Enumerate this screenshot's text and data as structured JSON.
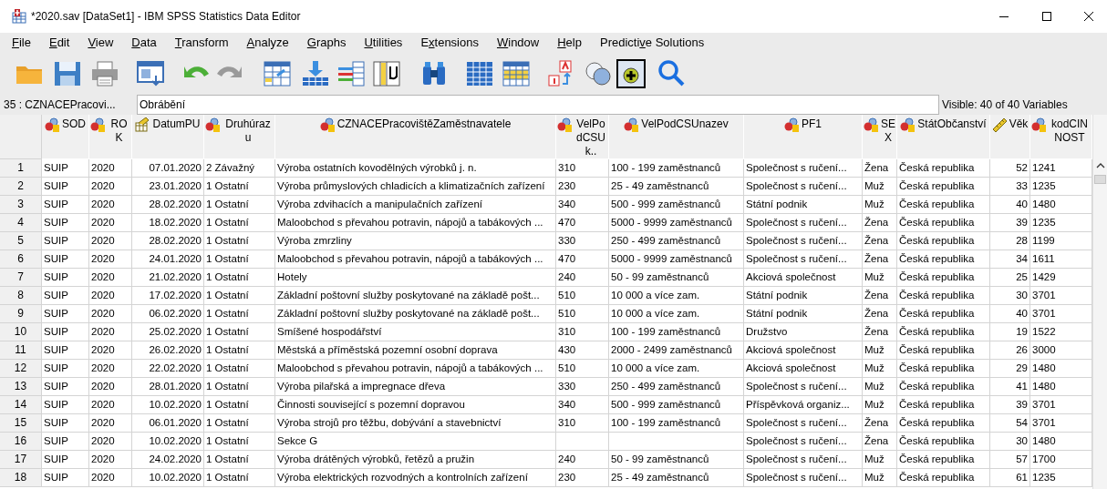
{
  "window": {
    "title": "*2020.sav [DataSet1] - IBM SPSS Statistics Data Editor"
  },
  "menu": [
    {
      "access_key": "F",
      "after": "ile"
    },
    {
      "access_key": "E",
      "after": "dit"
    },
    {
      "access_key": "V",
      "after": "iew"
    },
    {
      "access_key": "D",
      "after": "ata"
    },
    {
      "access_key": "T",
      "after": "ransform"
    },
    {
      "access_key": "A",
      "after": "nalyze"
    },
    {
      "access_key": "G",
      "after": "raphs"
    },
    {
      "access_key": "U",
      "after": "tilities"
    },
    {
      "before": "E",
      "access_key": "x",
      "after": "tensions"
    },
    {
      "access_key": "W",
      "after": "indow"
    },
    {
      "access_key": "H",
      "after": "elp"
    },
    {
      "before": "Predicti",
      "access_key": "v",
      "after": "e Solutions"
    }
  ],
  "cell_editor": {
    "cell_reference": "35 : CZNACEPracovi...",
    "value": "Obrábění",
    "visible_variables": "Visible: 40 of 40 Variables"
  },
  "table": {
    "columns": [
      {
        "label": "SOD",
        "kind": "nominal"
      },
      {
        "label": "ROK",
        "kind": "nominal"
      },
      {
        "label": "DatumPU",
        "kind": "date"
      },
      {
        "label": "Druhúrazu",
        "kind": "nominal"
      },
      {
        "label": "CZNACEPracovištěZaměstnavatele",
        "kind": "nominal"
      },
      {
        "label": "VelPodCSUk..",
        "kind": "nominal"
      },
      {
        "label": "VelPodCSUnazev",
        "kind": "nominal"
      },
      {
        "label": "PF1",
        "kind": "nominal"
      },
      {
        "label": "SEX",
        "kind": "nominal"
      },
      {
        "label": "StátObčanství",
        "kind": "nominal"
      },
      {
        "label": "Věk",
        "kind": "scale"
      },
      {
        "label": "kodCINNOST",
        "kind": "nominal"
      }
    ],
    "rows": [
      {
        "number": "1",
        "cells": [
          "SUIP",
          "2020",
          "07.01.2020",
          "2 Závažný",
          "Výroba ostatních kovodělných výrobků j. n.",
          "310",
          "100 - 199 zaměstnanců",
          "Společnost s ručení...",
          "Žena",
          "Česká republika",
          "52",
          "1241"
        ]
      },
      {
        "number": "2",
        "cells": [
          "SUIP",
          "2020",
          "23.01.2020",
          "1 Ostatní",
          "Výroba průmyslových chladicích a klimatizačních zařízení",
          "230",
          "25 - 49 zaměstnanců",
          "Společnost s ručení...",
          "Muž",
          "Česká republika",
          "33",
          "1235"
        ]
      },
      {
        "number": "3",
        "cells": [
          "SUIP",
          "2020",
          "28.02.2020",
          "1 Ostatní",
          "Výroba zdvihacích a manipulačních zařízení",
          "340",
          "500 - 999 zaměstnanců",
          "Státní podnik",
          "Muž",
          "Česká republika",
          "40",
          "1480"
        ]
      },
      {
        "number": "4",
        "cells": [
          "SUIP",
          "2020",
          "18.02.2020",
          "1 Ostatní",
          "Maloobchod s převahou potravin, nápojů a tabákových ...",
          "470",
          "5000 - 9999 zaměstnanců",
          "Společnost s ručení...",
          "Žena",
          "Česká republika",
          "39",
          "1235"
        ]
      },
      {
        "number": "5",
        "cells": [
          "SUIP",
          "2020",
          "28.02.2020",
          "1 Ostatní",
          "Výroba zmrzliny",
          "330",
          "250 - 499 zaměstnanců",
          "Společnost s ručení...",
          "Žena",
          "Česká republika",
          "28",
          "1199"
        ]
      },
      {
        "number": "6",
        "cells": [
          "SUIP",
          "2020",
          "24.01.2020",
          "1 Ostatní",
          "Maloobchod s převahou potravin, nápojů a tabákových ...",
          "470",
          "5000 - 9999 zaměstnanců",
          "Společnost s ručení...",
          "Žena",
          "Česká republika",
          "34",
          "1611"
        ]
      },
      {
        "number": "7",
        "cells": [
          "SUIP",
          "2020",
          "21.02.2020",
          "1 Ostatní",
          "Hotely",
          "240",
          "50 - 99 zaměstnanců",
          "Akciová společnost",
          "Muž",
          "Česká republika",
          "25",
          "1429"
        ]
      },
      {
        "number": "8",
        "cells": [
          "SUIP",
          "2020",
          "17.02.2020",
          "1 Ostatní",
          "Základní poštovní služby poskytované na základě pošt...",
          "510",
          "10 000 a více zam.",
          "Státní podnik",
          "Žena",
          "Česká republika",
          "30",
          "3701"
        ]
      },
      {
        "number": "9",
        "cells": [
          "SUIP",
          "2020",
          "06.02.2020",
          "1 Ostatní",
          "Základní poštovní služby poskytované na základě pošt...",
          "510",
          "10 000 a více zam.",
          "Státní podnik",
          "Žena",
          "Česká republika",
          "40",
          "3701"
        ]
      },
      {
        "number": "10",
        "cells": [
          "SUIP",
          "2020",
          "25.02.2020",
          "1 Ostatní",
          "Smíšené hospodářství",
          "310",
          "100 - 199 zaměstnanců",
          "Družstvo",
          "Žena",
          "Česká republika",
          "19",
          "1522"
        ]
      },
      {
        "number": "11",
        "cells": [
          "SUIP",
          "2020",
          "26.02.2020",
          "1 Ostatní",
          "Městská a příměstská pozemní osobní doprava",
          "430",
          "2000 - 2499 zaměstnanců",
          "Akciová společnost",
          "Muž",
          "Česká republika",
          "26",
          "3000"
        ]
      },
      {
        "number": "12",
        "cells": [
          "SUIP",
          "2020",
          "22.02.2020",
          "1 Ostatní",
          "Maloobchod s převahou potravin, nápojů a tabákových ...",
          "510",
          "10 000 a více zam.",
          "Akciová společnost",
          "Muž",
          "Česká republika",
          "29",
          "1480"
        ]
      },
      {
        "number": "13",
        "cells": [
          "SUIP",
          "2020",
          "28.01.2020",
          "1 Ostatní",
          "Výroba pilařská a impregnace dřeva",
          "330",
          "250 - 499 zaměstnanců",
          "Společnost s ručení...",
          "Muž",
          "Česká republika",
          "41",
          "1480"
        ]
      },
      {
        "number": "14",
        "cells": [
          "SUIP",
          "2020",
          "10.02.2020",
          "1 Ostatní",
          "Činnosti související s pozemní dopravou",
          "340",
          "500 - 999 zaměstnanců",
          "Příspěvková organiz...",
          "Muž",
          "Česká republika",
          "39",
          "3701"
        ]
      },
      {
        "number": "15",
        "cells": [
          "SUIP",
          "2020",
          "06.01.2020",
          "1 Ostatní",
          "Výroba strojů pro těžbu, dobývání a stavebnictví",
          "310",
          "100 - 199 zaměstnanců",
          "Společnost s ručení...",
          "Žena",
          "Česká republika",
          "54",
          "3701"
        ]
      },
      {
        "number": "16",
        "cells": [
          "SUIP",
          "2020",
          "10.02.2020",
          "1 Ostatní",
          "Sekce G",
          null,
          null,
          "Společnost s ručení...",
          "Žena",
          "Česká republika",
          "30",
          "1480"
        ]
      },
      {
        "number": "17",
        "cells": [
          "SUIP",
          "2020",
          "24.02.2020",
          "1 Ostatní",
          "Výroba drátěných výrobků, řetězů a pružin",
          "240",
          "50 - 99 zaměstnanců",
          "Společnost s ručení...",
          "Muž",
          "Česká republika",
          "57",
          "1700"
        ]
      },
      {
        "number": "18",
        "cells": [
          "SUIP",
          "2020",
          "10.02.2020",
          "1 Ostatní",
          "Výroba elektrických rozvodných a kontrolních zařízení",
          "230",
          "25 - 49 zaměstnanců",
          "Společnost s ručení...",
          "Muž",
          "Česká republika",
          "61",
          "1235"
        ]
      }
    ]
  }
}
